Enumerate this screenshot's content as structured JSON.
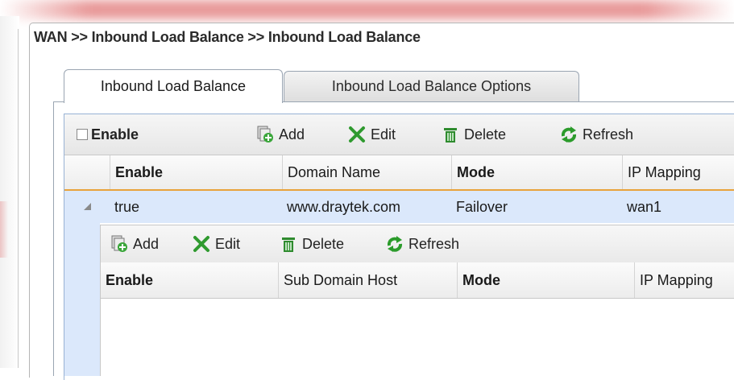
{
  "page": {
    "title": "WAN >> Inbound Load Balance >> Inbound Load Balance"
  },
  "tabs": [
    {
      "label": "Inbound Load Balance",
      "active": true
    },
    {
      "label": "Inbound Load Balance Options",
      "active": false
    }
  ],
  "toolbar": {
    "enable_label": "Enable",
    "add_label": "Add",
    "edit_label": "Edit",
    "delete_label": "Delete",
    "refresh_label": "Refresh"
  },
  "table": {
    "columns": [
      "Enable",
      "Domain Name",
      "Mode",
      "IP Mapping"
    ],
    "rows": [
      {
        "enable": "true",
        "domain": "www.draytek.com",
        "mode": "Failover",
        "ip_mapping": "wan1"
      }
    ]
  },
  "sub_toolbar": {
    "add_label": "Add",
    "edit_label": "Edit",
    "delete_label": "Delete",
    "refresh_label": "Refresh"
  },
  "sub_table": {
    "columns": [
      "Enable",
      "Sub Domain Host",
      "Mode",
      "IP Mapping"
    ]
  },
  "colors": {
    "selected_row": "#dbe8fb",
    "header_accent": "#e8a23b",
    "add_icon": "#3aa63a",
    "edit_icon": "#2f9a2f",
    "delete_icon": "#2e8b2e",
    "refresh_icon": "#2b9b2b"
  },
  "icons": {
    "add": "add-icon",
    "edit": "edit-icon",
    "delete": "delete-icon",
    "refresh": "refresh-icon",
    "collapse": "collapse-triangle-icon"
  }
}
